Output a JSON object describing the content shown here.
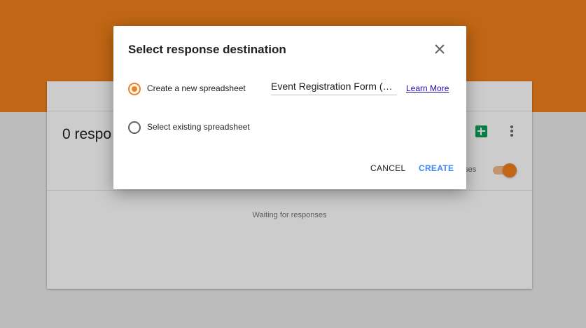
{
  "colors": {
    "accent": "#f2801a",
    "link": "#1a0dab",
    "primary_button": "#4285f4",
    "sheets_green": "#0f9d58"
  },
  "background": {
    "responses_title": "0 respo",
    "accepting_label": "nses",
    "waiting_text": "Waiting for responses",
    "icons": {
      "sheets": "sheets-icon",
      "more": "more-vert-icon"
    }
  },
  "dialog": {
    "title": "Select response destination",
    "close_icon": "close-icon",
    "options": [
      {
        "label": "Create a new spreadsheet",
        "selected": true
      },
      {
        "label": "Select existing spreadsheet",
        "selected": false
      }
    ],
    "spreadsheet_name": "Event Registration Form (R...",
    "learn_more": "Learn More",
    "cancel_label": "CANCEL",
    "create_label": "CREATE"
  }
}
